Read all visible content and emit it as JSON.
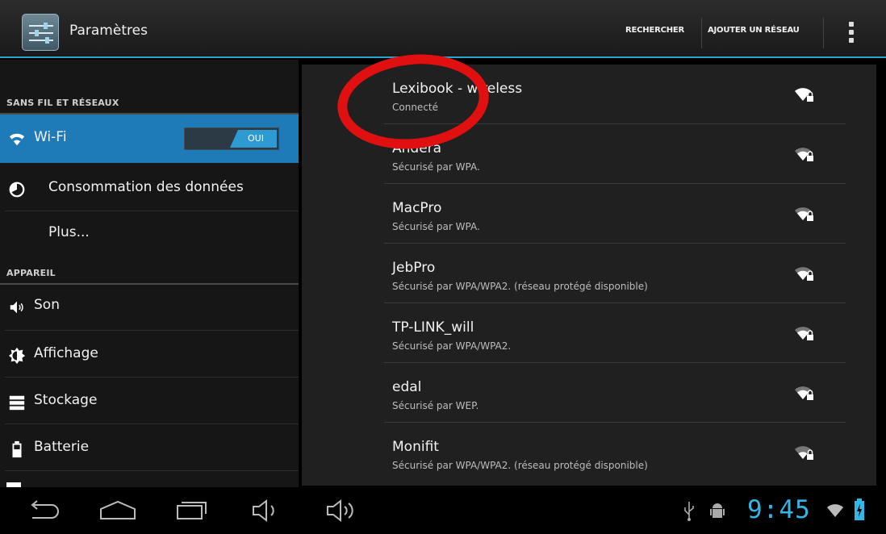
{
  "actionbar": {
    "title": "Paramètres",
    "search_label": "RECHERCHER",
    "add_network_label": "AJOUTER UN RÉSEAU"
  },
  "sidebar": {
    "sections": [
      {
        "header": "SANS FIL ET RÉSEAUX"
      },
      {
        "header": "APPAREIL"
      }
    ],
    "items": [
      {
        "label": "Wi-Fi",
        "icon": "wifi-icon",
        "toggle": "OUI",
        "selected": true
      },
      {
        "label": "Consommation des données",
        "icon": "data-usage-icon"
      },
      {
        "label": "Plus...",
        "icon": ""
      },
      {
        "label": "Son",
        "icon": "speaker-icon"
      },
      {
        "label": "Affichage",
        "icon": "brightness-icon"
      },
      {
        "label": "Stockage",
        "icon": "storage-icon"
      },
      {
        "label": "Batterie",
        "icon": "battery-icon"
      }
    ]
  },
  "networks": [
    {
      "name": "Lexibook - wireless",
      "status": "Connecté"
    },
    {
      "name": "Andera",
      "status": "Sécurisé par WPA."
    },
    {
      "name": "MacPro",
      "status": "Sécurisé par WPA."
    },
    {
      "name": "JebPro",
      "status": "Sécurisé par WPA/WPA2. (réseau protégé disponible)"
    },
    {
      "name": "TP-LINK_will",
      "status": "Sécurisé par WPA/WPA2."
    },
    {
      "name": "edal",
      "status": "Sécurisé par WEP."
    },
    {
      "name": "Monifit",
      "status": "Sécurisé par WPA/WPA2. (réseau protégé disponible)"
    }
  ],
  "statusbar": {
    "time": "9:45"
  },
  "colors": {
    "accent": "#33b5e5",
    "selected": "#1f7ab8",
    "annotation": "#e01010"
  }
}
